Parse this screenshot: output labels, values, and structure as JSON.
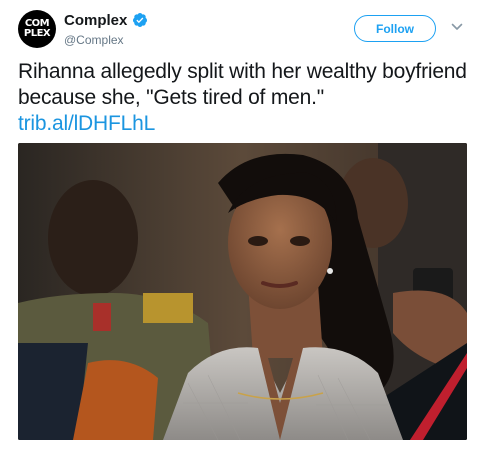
{
  "account": {
    "avatar_text_line1": "COM",
    "avatar_text_line2": "PLEX",
    "display_name": "Complex",
    "handle": "@Complex",
    "verified_icon": "verified-badge-icon"
  },
  "follow_button": {
    "label": "Follow"
  },
  "menu_icon": "chevron-down-icon",
  "tweet": {
    "text": "Rihanna allegedly split with her wealthy boyfriend because she, \"Gets tired of men.\"",
    "link": "trib.al/lDHFLhL"
  },
  "colors": {
    "accent": "#1da1f2",
    "link": "#1b95e0",
    "text": "#14171a",
    "secondary": "#657786"
  }
}
